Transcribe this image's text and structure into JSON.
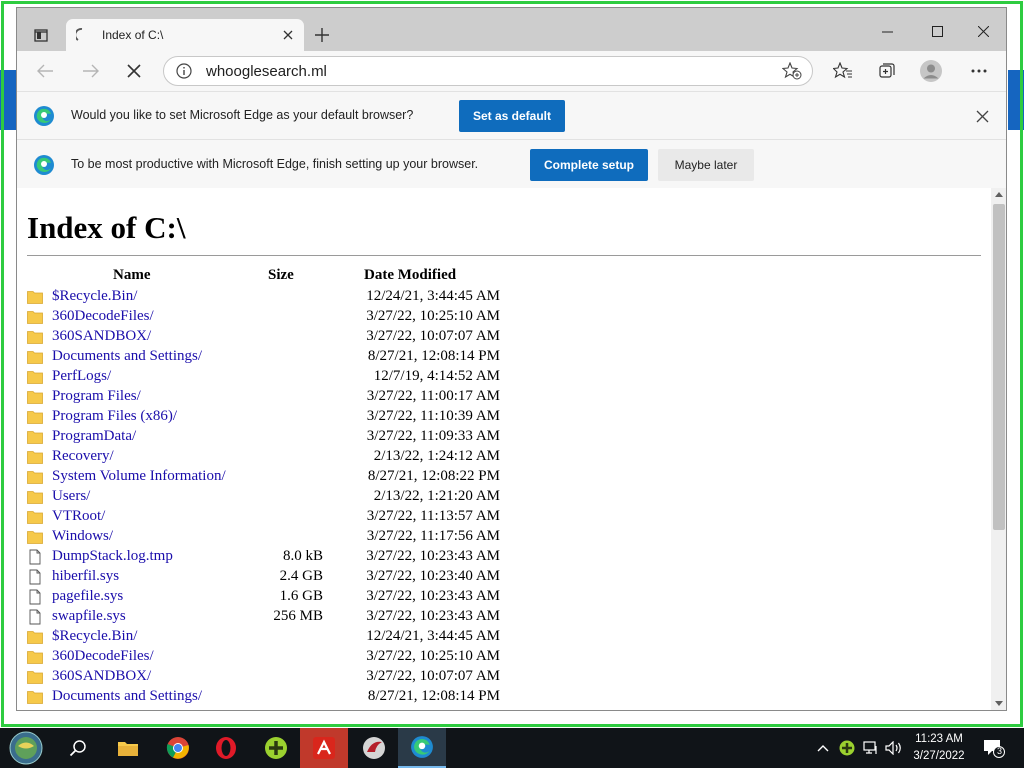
{
  "window": {
    "tab_title": "Index of C:\\",
    "new_tab_glyph": "+"
  },
  "toolbar": {
    "url": "whooglesearch.ml"
  },
  "infobar_default": {
    "message": "Would you like to set Microsoft Edge as your default browser?",
    "button": "Set as default"
  },
  "infobar_setup": {
    "message": "To be most productive with Microsoft Edge, finish setting up your browser.",
    "primary_button": "Complete setup",
    "secondary_button": "Maybe later"
  },
  "page": {
    "heading": "Index of C:\\",
    "columns": {
      "name": "Name",
      "size": "Size",
      "date": "Date Modified"
    },
    "entries": [
      {
        "name": "$Recycle.Bin/",
        "size": "",
        "date": "12/24/21, 3:44:45 AM",
        "icon": "folder-icon"
      },
      {
        "name": "360DecodeFiles/",
        "size": "",
        "date": "3/27/22, 10:25:10 AM",
        "icon": "folder-icon"
      },
      {
        "name": "360SANDBOX/",
        "size": "",
        "date": "3/27/22, 10:07:07 AM",
        "icon": "folder-icon"
      },
      {
        "name": "Documents and Settings/",
        "size": "",
        "date": "8/27/21, 12:08:14 PM",
        "icon": "folder-icon"
      },
      {
        "name": "PerfLogs/",
        "size": "",
        "date": "12/7/19, 4:14:52 AM",
        "icon": "folder-icon"
      },
      {
        "name": "Program Files/",
        "size": "",
        "date": "3/27/22, 11:00:17 AM",
        "icon": "folder-icon"
      },
      {
        "name": "Program Files (x86)/",
        "size": "",
        "date": "3/27/22, 11:10:39 AM",
        "icon": "folder-icon"
      },
      {
        "name": "ProgramData/",
        "size": "",
        "date": "3/27/22, 11:09:33 AM",
        "icon": "folder-icon"
      },
      {
        "name": "Recovery/",
        "size": "",
        "date": "2/13/22, 1:24:12 AM",
        "icon": "folder-icon"
      },
      {
        "name": "System Volume Information/",
        "size": "",
        "date": "8/27/21, 12:08:22 PM",
        "icon": "folder-icon"
      },
      {
        "name": "Users/",
        "size": "",
        "date": "2/13/22, 1:21:20 AM",
        "icon": "folder-icon"
      },
      {
        "name": "VTRoot/",
        "size": "",
        "date": "3/27/22, 11:13:57 AM",
        "icon": "folder-icon"
      },
      {
        "name": "Windows/",
        "size": "",
        "date": "3/27/22, 11:17:56 AM",
        "icon": "folder-icon"
      },
      {
        "name": "DumpStack.log.tmp",
        "size": "8.0 kB",
        "date": "3/27/22, 10:23:43 AM",
        "icon": "file-icon"
      },
      {
        "name": "hiberfil.sys",
        "size": "2.4 GB",
        "date": "3/27/22, 10:23:40 AM",
        "icon": "file-icon"
      },
      {
        "name": "pagefile.sys",
        "size": "1.6 GB",
        "date": "3/27/22, 10:23:43 AM",
        "icon": "file-icon"
      },
      {
        "name": "swapfile.sys",
        "size": "256 MB",
        "date": "3/27/22, 10:23:43 AM",
        "icon": "file-icon"
      },
      {
        "name": "$Recycle.Bin/",
        "size": "",
        "date": "12/24/21, 3:44:45 AM",
        "icon": "folder-icon"
      },
      {
        "name": "360DecodeFiles/",
        "size": "",
        "date": "3/27/22, 10:25:10 AM",
        "icon": "folder-icon"
      },
      {
        "name": "360SANDBOX/",
        "size": "",
        "date": "3/27/22, 10:07:07 AM",
        "icon": "folder-icon"
      },
      {
        "name": "Documents and Settings/",
        "size": "",
        "date": "8/27/21, 12:08:14 PM",
        "icon": "folder-icon"
      }
    ]
  },
  "taskbar": {
    "time": "11:23 AM",
    "date": "3/27/2022",
    "notification_count": "3",
    "apps": [
      "start-orb",
      "search-icon",
      "file-explorer-icon",
      "chrome-icon",
      "opera-icon",
      "plus-app-icon",
      "avira-icon",
      "reddit-like-icon",
      "edge-icon"
    ]
  },
  "colors": {
    "accent": "#0f6cbd",
    "link": "#1a0dab",
    "highlight_border": "#2ecc40",
    "folder": "#f6c94a"
  }
}
